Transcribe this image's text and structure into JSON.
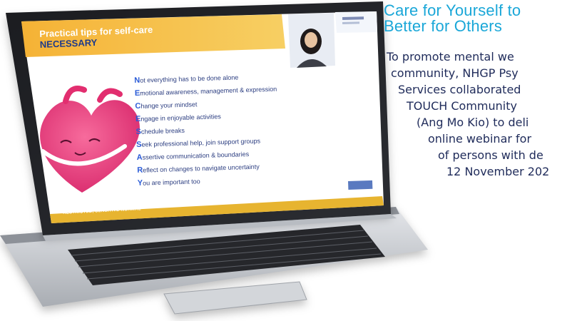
{
  "article": {
    "title_line1": "Care for Yourself to",
    "title_line2": "Better for Others",
    "body_lines": [
      "To promote mental we",
      "community, NHGP Psy",
      "Services collaborated",
      "TOUCH Community",
      "(Ang Mo Kio) to deli",
      "online webinar for",
      "of persons with de",
      "12 November 202"
    ]
  },
  "slide": {
    "title": "Practical tips for self-care",
    "subtitle": "NECESSARY",
    "tips": [
      {
        "cap": "N",
        "rest": "ot everything has to be done alone"
      },
      {
        "cap": "E",
        "rest": "motional awareness, management & expression"
      },
      {
        "cap": "C",
        "rest": "hange your mindset"
      },
      {
        "cap": "E",
        "rest": "ngage in enjoyable activities"
      },
      {
        "cap": "S",
        "rest": "chedule breaks"
      },
      {
        "cap": "S",
        "rest": "eek professional help, join support groups"
      },
      {
        "cap": "A",
        "rest": "ssertive communication & boundaries"
      },
      {
        "cap": "R",
        "rest": "eflect on changes to navigate uncertainty"
      },
      {
        "cap": "Y",
        "rest": "ou are important too"
      }
    ],
    "footer": "RESTRICTED, SENSITIVE-NORMAL"
  },
  "colors": {
    "title_blue": "#1aa7d8",
    "body_navy": "#1f2b5a",
    "slide_banner": "#f4b942",
    "heart_pink": "#ec3f7c",
    "laptop_silver": "#c9ccd1"
  }
}
